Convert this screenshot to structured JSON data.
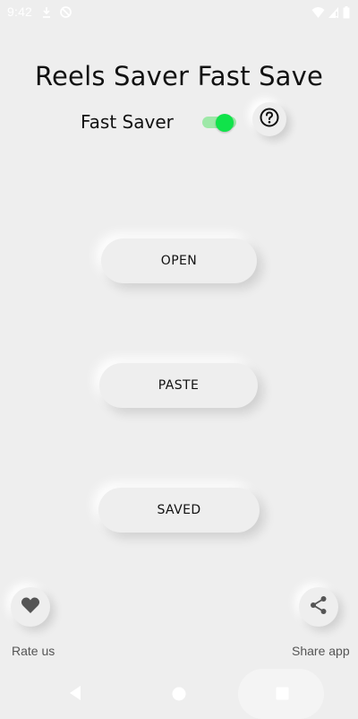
{
  "status_bar": {
    "time": "9:42",
    "icons": [
      "download-icon",
      "sync-icon",
      "wifi-icon",
      "signal-icon",
      "battery-icon"
    ]
  },
  "header": {
    "title": "Reels Saver Fast Save"
  },
  "fast_saver": {
    "label": "Fast Saver",
    "enabled": true,
    "accent_color": "#10e34a",
    "help_icon": "help-circle-icon"
  },
  "actions": {
    "open_label": "OPEN",
    "paste_label": "PASTE",
    "saved_label": "SAVED"
  },
  "footer": {
    "rate_label": "Rate us",
    "rate_icon": "heart-icon",
    "share_label": "Share app",
    "share_icon": "share-icon"
  },
  "nav": {
    "back_icon": "back-icon",
    "home_icon": "home-icon",
    "recents_icon": "recents-icon"
  }
}
